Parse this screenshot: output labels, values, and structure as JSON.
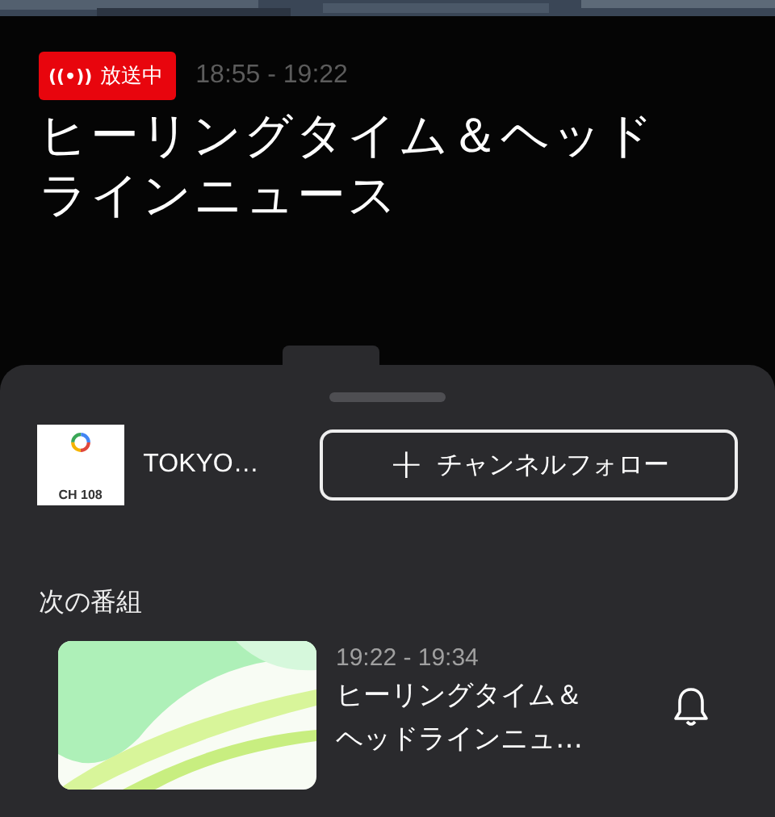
{
  "now_playing": {
    "badge": {
      "icon": "((•))",
      "label": "放送中"
    },
    "time": "18:55 - 19:22",
    "title": "ヒーリングタイム＆ヘッドラインニュース"
  },
  "sheet": {
    "channel": {
      "logo_caption": "CH 108",
      "name": "TOKYO…"
    },
    "follow_button": {
      "icon": "+",
      "label": "チャンネルフォロー"
    },
    "next_heading": "次の番組",
    "next_programs": [
      {
        "time": "19:22 - 19:34",
        "title": "ヒーリングタイム＆ヘッドラインニュ…",
        "reminder_on": false
      }
    ]
  }
}
